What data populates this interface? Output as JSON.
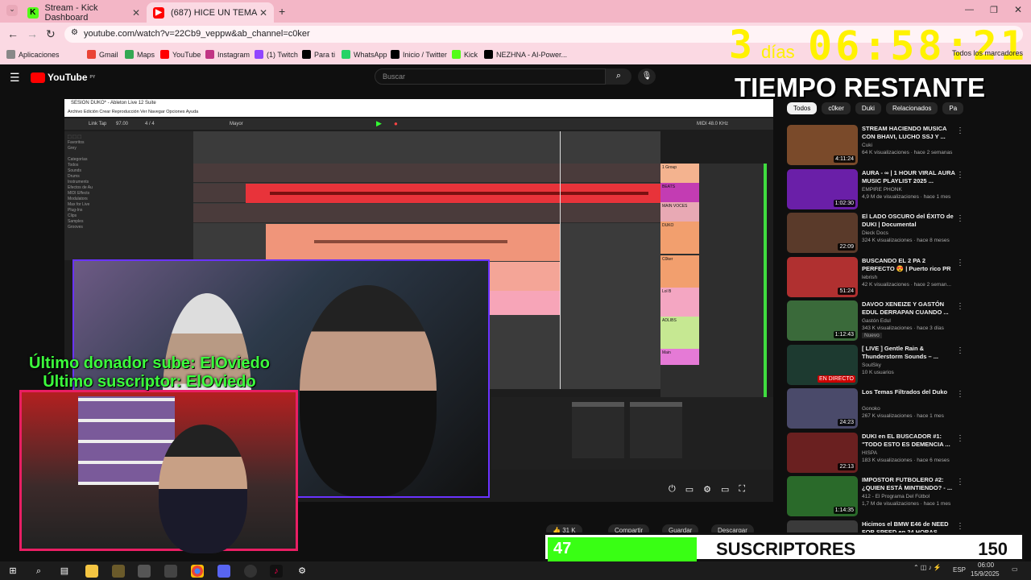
{
  "browser": {
    "tabs": [
      {
        "title": "Stream - Kick Dashboard",
        "icon": "kick-icon",
        "color": "#53fc18"
      },
      {
        "title": "(687) HICE UN TEMA CON",
        "icon": "youtube-icon",
        "color": "#ff0000"
      }
    ],
    "url": "youtube.com/watch?v=22Cb9_veppw&ab_channel=c0ker",
    "bookmarks": [
      {
        "label": "Aplicaciones",
        "color": "#888"
      },
      {
        "label": "Gmail",
        "color": "#ea4335"
      },
      {
        "label": "Maps",
        "color": "#34a853"
      },
      {
        "label": "YouTube",
        "color": "#ff0000"
      },
      {
        "label": "Instagram",
        "color": "#c13584"
      },
      {
        "label": "(1) Twitch",
        "color": "#9146ff"
      },
      {
        "label": "Para ti",
        "color": "#000"
      },
      {
        "label": "WhatsApp",
        "color": "#25d366"
      },
      {
        "label": "Inicio / Twitter",
        "color": "#000"
      },
      {
        "label": "Kick",
        "color": "#53fc18"
      },
      {
        "label": "NEZHNA - AI-Power...",
        "color": "#000"
      }
    ],
    "all_bookmarks": "Todos los marcadores"
  },
  "youtube": {
    "logo": "YouTube",
    "region": "PY",
    "search_placeholder": "Buscar",
    "chips": [
      "Todos",
      "c0ker",
      "Duki",
      "Relacionados",
      "Pa"
    ],
    "recs": [
      {
        "title": "STREAM HACIENDO MUSICA CON BHAVI, LUCHO SSJ Y ...",
        "channel": "Cuki",
        "meta": "64 K visualizaciones · hace 2 semanas",
        "dur": "4:11:24",
        "color": "#7a4a2a"
      },
      {
        "title": "AURA - ∞ | 1 HOUR VIRAL AURA MUSIC PLAYLIST 2025 ...",
        "channel": "EMPIRE PHONK",
        "meta": "4,9 M de visualizaciones · hace 1 mes",
        "dur": "1:02:30",
        "color": "#6a1fa8"
      },
      {
        "title": "El LADO OSCURO del ÉXITO de DUKI | Documental",
        "channel": "Dieck Docs",
        "meta": "324 K visualizaciones · hace 8 meses",
        "dur": "22:09",
        "color": "#5a3a2a"
      },
      {
        "title": "BUSCANDO EL 2 PA 2 PERFECTO 😍 | Puerto rico PR",
        "channel": "lebrish",
        "meta": "42 K visualizaciones · hace 2 seman...",
        "dur": "51:24",
        "color": "#b03030"
      },
      {
        "title": "DAVOO XENEIZE Y GASTÓN EDUL DERRAPAN CUANDO ...",
        "channel": "Gastón Edul",
        "meta": "343 K visualizaciones · hace 3 días",
        "dur": "1:12:43",
        "color": "#3a6a3a",
        "badge": "Nuevo"
      },
      {
        "title": "[ LIVE ] Gentle Rain & Thunderstorm Sounds – ...",
        "channel": "SoulSky",
        "meta": "10 K usuarios",
        "dur": "EN DIRECTO",
        "color": "#1d3a30"
      },
      {
        "title": "Los Temas Filtrados del Duko",
        "channel": "Gonoko",
        "meta": "267 K visualizaciones · hace 1 mes",
        "dur": "24:23",
        "color": "#4a4a6a"
      },
      {
        "title": "DUKI en EL BUSCADOR #1: \"TODO ESTO ES DEMENCIA ...",
        "channel": "HISPA",
        "meta": "183 K visualizaciones · hace 6 meses",
        "dur": "22:13",
        "color": "#6a2020"
      },
      {
        "title": "IMPOSTOR FUTBOLERO #2: ¿QUIEN ESTÁ MINTIENDO? - ...",
        "channel": "412 - El Programa Del Fútbol",
        "meta": "1,7 M de visualizaciones · hace 1 mes",
        "dur": "1:14:35",
        "color": "#2a6a2a"
      },
      {
        "title": "Hicimos el BMW E46 de NEED FOR SPEED en 24 HORAS",
        "channel": "Kenyi Nakamura",
        "meta": "3,6 M de visualizaciones · hace 1 mes",
        "dur": "40:16",
        "color": "#3a3a3a"
      }
    ],
    "actions": {
      "likes": "31 K",
      "share": "Compartir",
      "save": "Guardar",
      "download": "Descargar"
    }
  },
  "ableton": {
    "title": "SESION DUKO* - Ableton Live 12 Suite",
    "menu": "Archivo  Edición  Crear  Reproducción  Ver  Navegar  Opciones  Ayuda",
    "tempo": "97.00",
    "sig": "4 / 4",
    "key": "Mayor",
    "midi": "MIDI  48.0 KHz"
  },
  "overlay": {
    "timer": "3 días 06:58:21",
    "timer_days": "3",
    "timer_days_word": "días",
    "timer_clock": "06:58:21",
    "tiempo": "TIEMPO RESTANTE",
    "donor": "Último donador sube: ElOviedo",
    "subscriber": "Último suscriptor: ElOviedo",
    "subs_current": "47",
    "subs_label": "SUSCRIPTORES",
    "subs_goal": "150",
    "subs_progress": 0.3133
  },
  "taskbar": {
    "lang": "ESP",
    "time": "06:00",
    "date": "15/9/2025"
  }
}
